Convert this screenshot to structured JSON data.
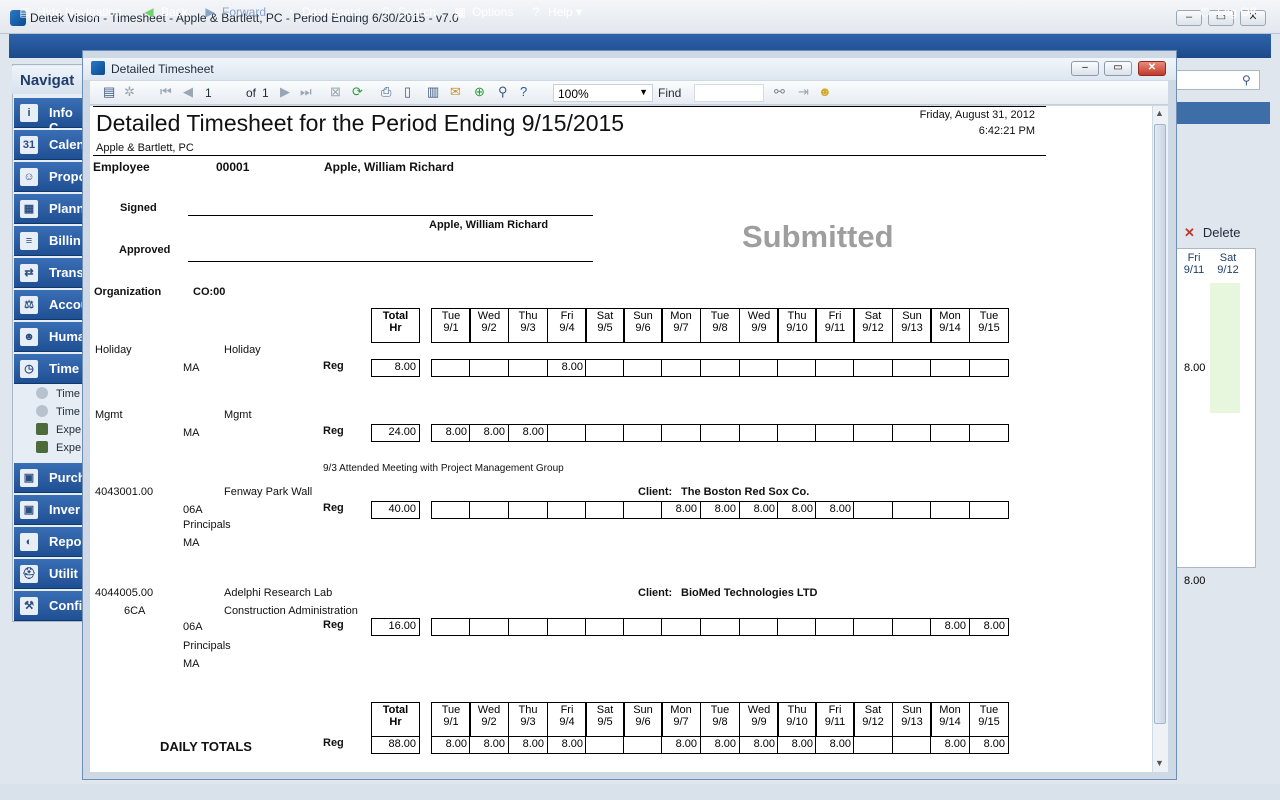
{
  "app": {
    "title": "Deltek Vision - Timesheet - Apple & Bartlett, PC - Period Ending 6/30/2015 - v7.0"
  },
  "nav": {
    "hide_navigation": "Hide Navigation",
    "back": "Back",
    "forward": "Forward",
    "dashboard": "Dashboard",
    "search": "Search",
    "options": "Options",
    "help": "Help",
    "log_off": "Log Off"
  },
  "left_nav": {
    "header": "Navigat",
    "items": [
      "Info C",
      "Calen",
      "Propo",
      "Plann",
      "Billin",
      "Trans",
      "Accou",
      "Huma",
      "Time"
    ],
    "sub_items": [
      "Time",
      "Time",
      "Expe",
      "Expe"
    ],
    "items2": [
      "Purch",
      "Inver",
      "Repo",
      "Utilit",
      "Confi"
    ]
  },
  "background": {
    "delete": "Delete",
    "col_fri": "Fri",
    "col_fri_date": "9/11",
    "col_sat": "Sat",
    "col_sat_date": "9/12",
    "value_1": "8.00",
    "value_2": "8.00"
  },
  "modal": {
    "title": "Detailed Timesheet",
    "page": "1",
    "of": "of",
    "total_pages": "1",
    "zoom": "100%",
    "find": "Find"
  },
  "report": {
    "title": "Detailed Timesheet for the Period Ending 9/15/2015",
    "company": "Apple & Bartlett, PC",
    "date": "Friday, August 31, 2012",
    "time": "6:42:21 PM",
    "employee_label": "Employee",
    "employee_id": "00001",
    "employee_name": "Apple, William Richard",
    "signed_label": "Signed",
    "signed_name": "Apple, William Richard",
    "approved_label": "Approved",
    "status": "Submitted",
    "org_label": "Organization",
    "org_value": "CO:00",
    "total_label_1": "Total",
    "total_label_2": "Hr",
    "days": [
      {
        "d": "Tue",
        "n": "9/1"
      },
      {
        "d": "Wed",
        "n": "9/2"
      },
      {
        "d": "Thu",
        "n": "9/3"
      },
      {
        "d": "Fri",
        "n": "9/4"
      },
      {
        "d": "Sat",
        "n": "9/5"
      },
      {
        "d": "Sun",
        "n": "9/6"
      },
      {
        "d": "Mon",
        "n": "9/7"
      },
      {
        "d": "Tue",
        "n": "9/8"
      },
      {
        "d": "Wed",
        "n": "9/9"
      },
      {
        "d": "Thu",
        "n": "9/10"
      },
      {
        "d": "Fri",
        "n": "9/11"
      },
      {
        "d": "Sat",
        "n": "9/12"
      },
      {
        "d": "Sun",
        "n": "9/13"
      },
      {
        "d": "Mon",
        "n": "9/14"
      },
      {
        "d": "Tue",
        "n": "9/15"
      }
    ],
    "rows": [
      {
        "project": "Holiday",
        "desc": "Holiday",
        "desc2": "",
        "sub": "MA",
        "sub2": "",
        "sub3": "",
        "type": "Reg",
        "total": "8.00",
        "values": [
          "",
          "",
          "",
          "8.00",
          "",
          "",
          "",
          "",
          "",
          "",
          "",
          "",
          "",
          "",
          ""
        ],
        "note": "",
        "client": "",
        "phase": ""
      },
      {
        "project": "Mgmt",
        "desc": "Mgmt",
        "desc2": "",
        "sub": "MA",
        "sub2": "",
        "sub3": "",
        "type": "Reg",
        "total": "24.00",
        "values": [
          "8.00",
          "8.00",
          "8.00",
          "",
          "",
          "",
          "",
          "",
          "",
          "",
          "",
          "",
          "",
          "",
          ""
        ],
        "note": "9/3 Attended Meeting with Project Management Group",
        "client": "",
        "phase": ""
      },
      {
        "project": "4043001.00",
        "desc": "Fenway Park Wall",
        "desc2": "Principals",
        "sub": "06A",
        "sub2": "MA",
        "sub3": "",
        "type": "Reg",
        "total": "40.00",
        "values": [
          "",
          "",
          "",
          "",
          "",
          "",
          "8.00",
          "8.00",
          "8.00",
          "8.00",
          "8.00",
          "",
          "",
          "",
          ""
        ],
        "note": "",
        "client": "The Boston Red Sox Co.",
        "phase": ""
      },
      {
        "project": "4044005.00",
        "desc": "Adelphi Research Lab",
        "desc2": "Construction Administration",
        "sub": "06A",
        "sub2": "Principals",
        "sub3": "MA",
        "type": "Reg",
        "total": "16.00",
        "values": [
          "",
          "",
          "",
          "",
          "",
          "",
          "",
          "",
          "",
          "",
          "",
          "",
          "",
          "8.00",
          "8.00"
        ],
        "note": "",
        "client": "BioMed Technologies LTD",
        "phase": "6CA"
      }
    ],
    "client_label": "Client:",
    "daily_totals_label": "DAILY TOTALS",
    "daily_totals_type": "Reg",
    "daily_totals_total": "88.00",
    "daily_totals": [
      "8.00",
      "8.00",
      "8.00",
      "8.00",
      "",
      "",
      "8.00",
      "8.00",
      "8.00",
      "8.00",
      "8.00",
      "",
      "",
      "8.00",
      "8.00"
    ]
  }
}
